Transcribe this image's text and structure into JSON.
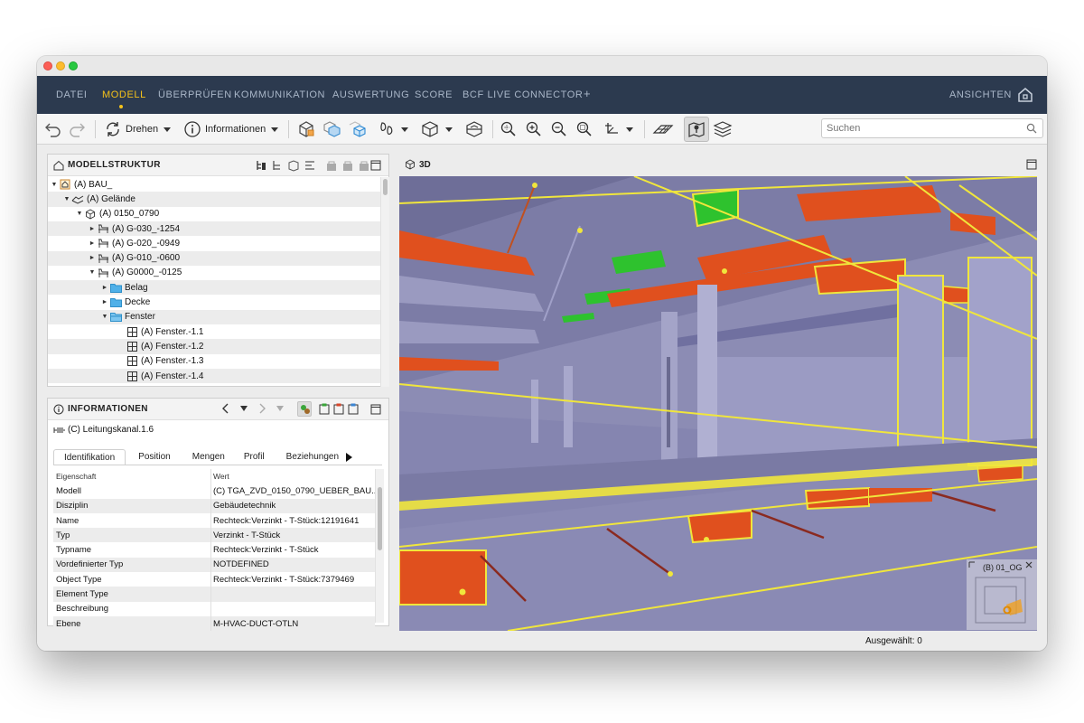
{
  "menu": {
    "items": [
      "DATEI",
      "MODELL",
      "ÜBERPRÜFEN",
      "KOMMUNIKATION",
      "AUSWERTUNG",
      "SCORE",
      "BCF LIVE CONNECTOR",
      "+"
    ],
    "active": "MODELL",
    "right": "ANSICHTEN",
    "accent_color": "#f5c21a",
    "background_color": "#2c3a4f"
  },
  "toolbar": {
    "rotate_label": "Drehen",
    "info_label": "Informationen",
    "search_placeholder": "Suchen",
    "icons": [
      "undo-icon",
      "redo-icon",
      "rotate-icon",
      "info-icon",
      "box-select-icon",
      "box-ghost-icon",
      "box-isolate-icon",
      "walk-icon",
      "cube-view-icon",
      "section-icon",
      "zoom-fit-icon",
      "zoom-in-icon",
      "zoom-out-icon",
      "zoom-window-icon",
      "measure-icon",
      "grid-plane-icon",
      "map-pin-icon",
      "layers-icon"
    ]
  },
  "model_tree": {
    "title": "MODELLSTRUKTUR",
    "rows": [
      {
        "label": "(A) BAU_",
        "caret": "▼",
        "icon": "building-icon"
      },
      {
        "label": "(A) Gelände",
        "caret": "▼",
        "icon": "terrain-icon"
      },
      {
        "label": "(A) 0150_0790",
        "caret": "▼",
        "icon": "cube-icon"
      },
      {
        "label": "(A) G-030_-1254",
        "caret": "►",
        "icon": "storey-icon"
      },
      {
        "label": "(A) G-020_-0949",
        "caret": "►",
        "icon": "storey-icon"
      },
      {
        "label": "(A) G-010_-0600",
        "caret": "►",
        "icon": "storey-icon"
      },
      {
        "label": "(A) G0000_-0125",
        "caret": "▼",
        "icon": "storey-icon"
      },
      {
        "label": "Belag",
        "caret": "►",
        "icon": "folder-icon"
      },
      {
        "label": "Decke",
        "caret": "►",
        "icon": "folder-icon"
      },
      {
        "label": "Fenster",
        "caret": "▼",
        "icon": "folder-open-icon"
      },
      {
        "label": "(A) Fenster.-1.1",
        "caret": "",
        "icon": "window-icon"
      },
      {
        "label": "(A) Fenster.-1.2",
        "caret": "",
        "icon": "window-icon"
      },
      {
        "label": "(A) Fenster.-1.3",
        "caret": "",
        "icon": "window-icon"
      },
      {
        "label": "(A) Fenster.-1.4",
        "caret": "",
        "icon": "window-icon"
      }
    ]
  },
  "info_panel": {
    "title": "INFORMATIONEN",
    "selected_element": "(C) Leitungskanal.1.6",
    "tabs": [
      "Identifikation",
      "Position",
      "Mengen",
      "Profil",
      "Beziehungen"
    ],
    "active_tab": "Identifikation",
    "columns": [
      "Eigenschaft",
      "Wert"
    ],
    "properties": [
      {
        "key": "Modell",
        "value": "(C) TGA_ZVD_0150_0790_UEBER_BAU..."
      },
      {
        "key": "Disziplin",
        "value": "Gebäudetechnik"
      },
      {
        "key": "Name",
        "value": "Rechteck:Verzinkt - T-Stück:12191641"
      },
      {
        "key": "Typ",
        "value": "Verzinkt - T-Stück"
      },
      {
        "key": "Typname",
        "value": "Rechteck:Verzinkt - T-Stück"
      },
      {
        "key": "Vordefinierter Typ",
        "value": "NOTDEFINED"
      },
      {
        "key": "Object Type",
        "value": "Rechteck:Verzinkt - T-Stück:7379469"
      },
      {
        "key": "Element Type",
        "value": ""
      },
      {
        "key": "Beschreibung",
        "value": ""
      },
      {
        "key": "Ebene",
        "value": "M-HVAC-DUCT-OTLN"
      }
    ]
  },
  "view3d": {
    "title": "3D",
    "minimap_label": "(B) 01_OG",
    "colors": {
      "background": "#8c8cb4",
      "duct": "#e0501e",
      "highlight": "#f0e63c",
      "selected": "#2ec22e"
    }
  },
  "status": {
    "selected": "Ausgewählt: 0"
  }
}
